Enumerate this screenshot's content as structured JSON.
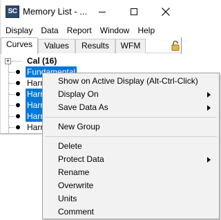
{
  "window": {
    "icon_text": "SC",
    "title": "Memory List - ..."
  },
  "menu_bar": {
    "items": [
      "Display",
      "Data",
      "Report",
      "Window",
      "Help"
    ]
  },
  "tabs": [
    "Curves",
    "Values",
    "Results",
    "WFM"
  ],
  "tree": {
    "root_label": "Cal (16)",
    "children": [
      "Fundamental",
      "Harr",
      "Harr",
      "Harr",
      "Harr",
      "Harr"
    ]
  },
  "context_menu": {
    "items": [
      "Show on Active Display (Alt-Ctrl-Click)",
      "Display On",
      "Save Data As",
      "New Group",
      "Delete",
      "Protect Data",
      "Rename",
      "Overwrite",
      "Units",
      "Comment"
    ]
  },
  "colors": {
    "selection": "#0078d7",
    "menu_background": "#f2f2f2",
    "app_icon": "#2f4a6b"
  }
}
